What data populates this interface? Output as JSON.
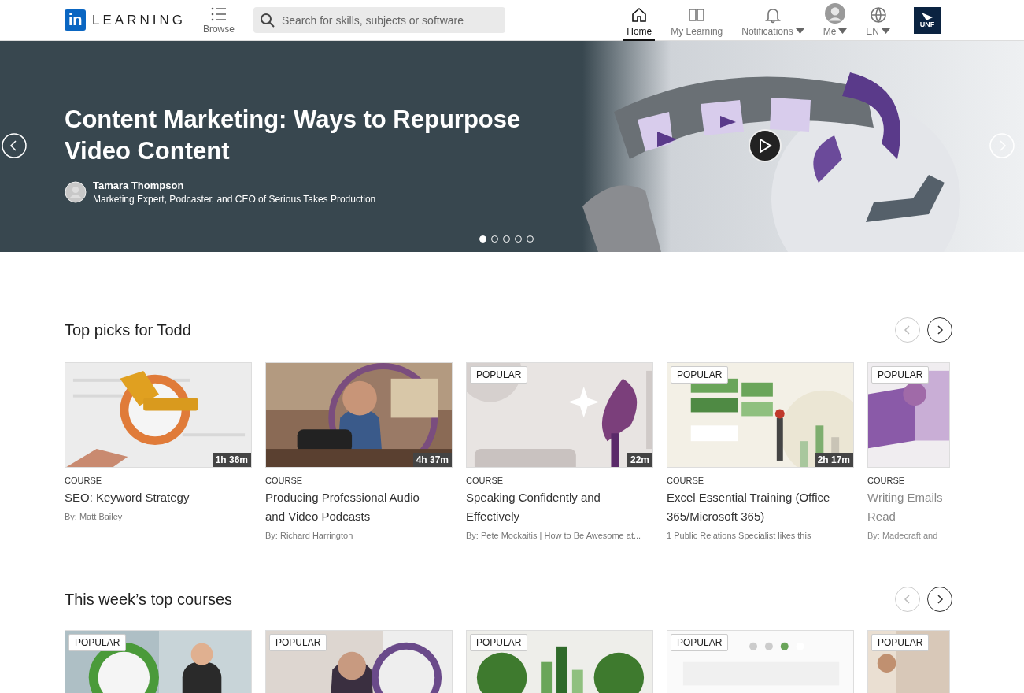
{
  "header": {
    "logo": {
      "mark": "in",
      "wordmark": "LEARNING"
    },
    "browse": "Browse",
    "search": {
      "placeholder": "Search for skills, subjects or software"
    },
    "nav": [
      {
        "kind": "home",
        "label": "Home",
        "selected": true,
        "dropdown": false
      },
      {
        "kind": "book",
        "label": "My Learning",
        "selected": false,
        "dropdown": false
      },
      {
        "kind": "bell",
        "label": "Notifications",
        "selected": false,
        "dropdown": true
      },
      {
        "kind": "avatar",
        "label": "Me",
        "selected": false,
        "dropdown": true
      },
      {
        "kind": "globe",
        "label": "EN",
        "selected": false,
        "dropdown": true
      }
    ],
    "org_logo": "UNF"
  },
  "hero": {
    "title": "Content Marketing: Ways to Repurpose Video Content",
    "author": "Tamara Thompson",
    "author_title": "Marketing Expert, Podcaster, and CEO of Serious Takes Production",
    "dots": [
      {
        "selected": true
      },
      {
        "selected": false
      },
      {
        "selected": false
      },
      {
        "selected": false
      },
      {
        "selected": false
      }
    ]
  },
  "sections": [
    {
      "title": "Top picks for Todd",
      "arrows": [
        {
          "kind": "prev",
          "disabled": true
        },
        {
          "kind": "next",
          "disabled": false
        }
      ],
      "cards": [
        {
          "type": "COURSE",
          "title_lines": [
            "SEO: Keyword Strategy"
          ],
          "duration": "1h 36m",
          "byline": "By: Matt Bailey"
        },
        {
          "type": "COURSE",
          "title_lines": [
            "Producing Professional Audio",
            "and Video Podcasts"
          ],
          "duration": "4h 37m",
          "byline": "By: Richard Harrington"
        },
        {
          "badge": "POPULAR",
          "type": "COURSE",
          "title_lines": [
            "Speaking Confidently and",
            "Effectively"
          ],
          "duration": "22m",
          "byline": "By: Pete Mockaitis | How to Be Awesome at..."
        },
        {
          "badge": "POPULAR",
          "type": "COURSE",
          "title_lines": [
            "Excel Essential Training (Office",
            "365/Microsoft 365)"
          ],
          "duration": "2h 17m",
          "byline": "1 Public Relations Specialist likes this"
        },
        {
          "badge": "POPULAR",
          "type": "COURSE",
          "title_lines": [
            "Writing Emails",
            "Read"
          ],
          "byline": "By: Madecraft and"
        }
      ]
    },
    {
      "title": "This week’s top courses",
      "arrows": [
        {
          "kind": "prev",
          "disabled": true
        },
        {
          "kind": "next",
          "disabled": false
        }
      ],
      "cards": [
        {
          "badge": "POPULAR"
        },
        {
          "badge": "POPULAR"
        },
        {
          "badge": "POPULAR"
        },
        {
          "badge": "POPULAR"
        },
        {
          "badge": "POPULAR"
        }
      ]
    }
  ]
}
